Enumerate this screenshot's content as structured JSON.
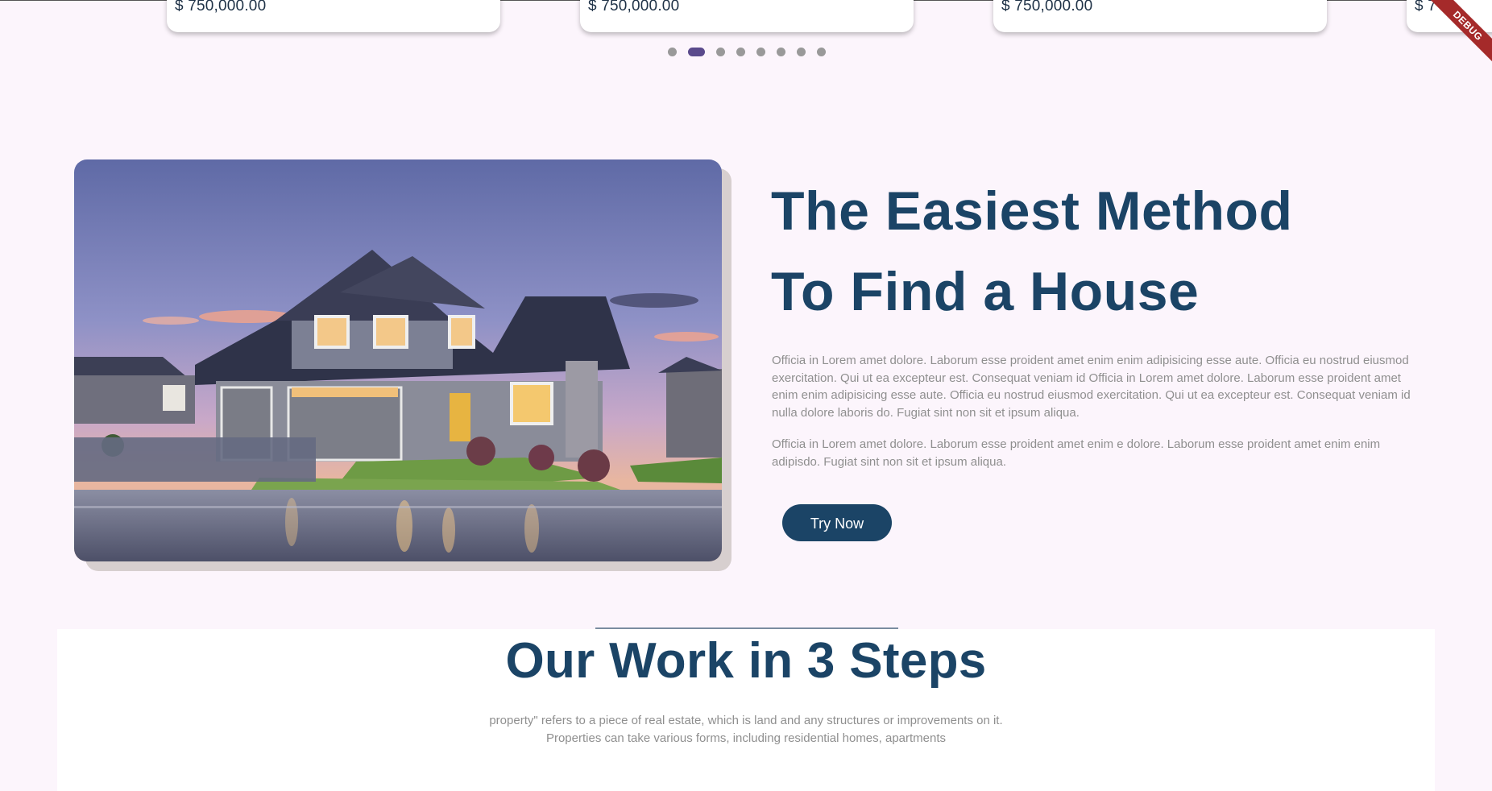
{
  "carousel": {
    "cards": [
      {
        "price": "$ 750,000.00"
      },
      {
        "price": "$ 750,000.00"
      },
      {
        "price": "$ 750,000.00"
      },
      {
        "price": "$ 7"
      }
    ],
    "dot_count": 8,
    "active_dot": 2
  },
  "debug_banner": "DEBUG",
  "hero": {
    "title_line_1": "The Easiest Method",
    "title_line_2": "To Find a House",
    "paragraph_1": "Officia in Lorem amet dolore. Laborum esse proident amet enim enim adipisicing esse aute. Officia eu nostrud eiusmod exercitation. Qui ut ea excepteur est. Consequat veniam id Officia in Lorem amet dolore. Laborum esse proident amet enim enim adipisicing esse aute. Officia eu nostrud eiusmod exercitation. Qui ut ea excepteur est. Consequat veniam id nulla dolore laboris do. Fugiat sint non sit et ipsum aliqua.",
    "paragraph_2": "Officia in Lorem amet dolore. Laborum esse proident amet enim e dolore. Laborum esse proident amet enim enim adipisdo. Fugiat sint non sit et ipsum aliqua.",
    "button_label": "Try Now",
    "image_alt": "house-at-dusk-photo"
  },
  "steps": {
    "title": "Our Work in 3 Steps",
    "description_line_1": "property\" refers to a piece of real estate, which is land and any structures or improvements on it.",
    "description_line_2": "Properties can take various forms, including residential homes, apartments"
  },
  "colors": {
    "primary": "#1b4466",
    "active_dot": "#5a4a8c",
    "background": "#fcf5fc",
    "muted_text": "#8f8f8f",
    "debug_ribbon": "#a52a2a"
  }
}
